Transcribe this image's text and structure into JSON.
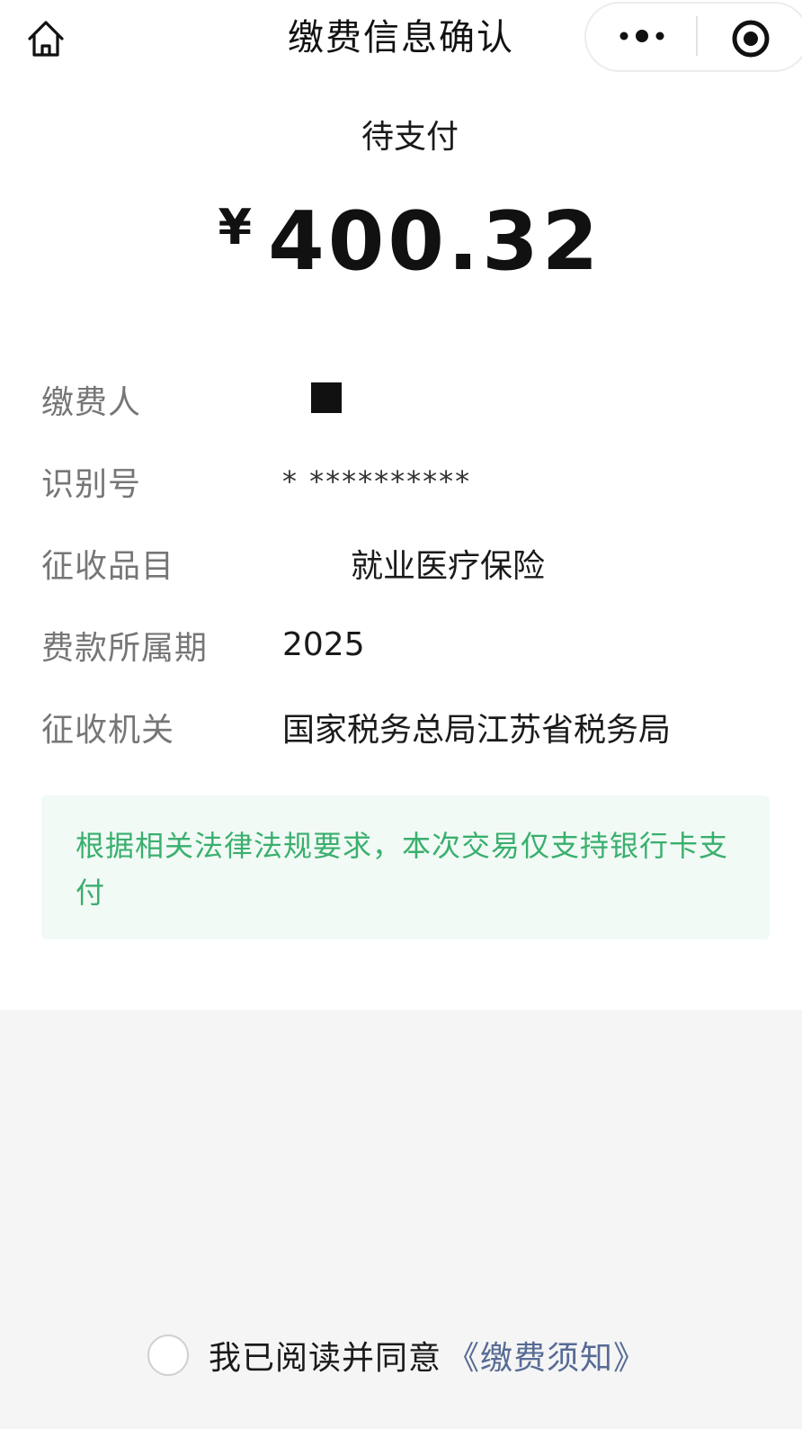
{
  "nav": {
    "title": "缴费信息确认",
    "home_icon": "home-icon",
    "more_icon": "more-dots-icon",
    "close_icon": "target-circle-icon"
  },
  "payment": {
    "status": "待支付",
    "currency": "¥",
    "amount": "400.32"
  },
  "info": [
    {
      "label": "缴费人",
      "value": ""
    },
    {
      "label": "识别号",
      "value": "*   **********"
    },
    {
      "label": "征收品目",
      "value": "就业医疗保险"
    },
    {
      "label": "费款所属期",
      "value": "2025"
    },
    {
      "label": "征收机关",
      "value": "国家税务总局江苏省税务局"
    }
  ],
  "notice": {
    "text": "根据相关法律法规要求，本次交易仅支持银行卡支付",
    "color": "#3aaf6e",
    "background": "#f1faf5"
  },
  "agreement": {
    "text": "我已阅读并同意",
    "link": "《缴费须知》",
    "checked": false,
    "link_color": "#576b95"
  }
}
